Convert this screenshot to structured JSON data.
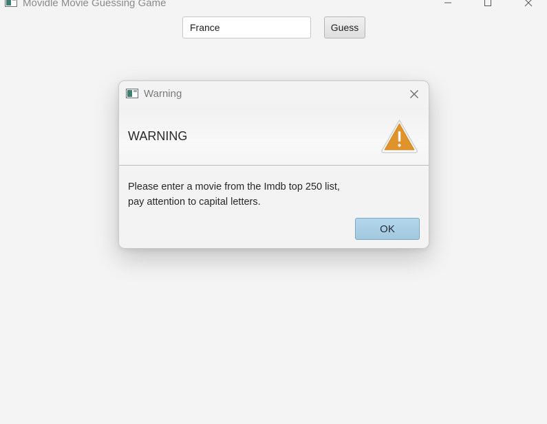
{
  "window": {
    "title": "Movidle Movie Guessing Game",
    "icon": "app-window-icon",
    "controls": {
      "minimize": "minimize-icon",
      "maximize": "maximize-icon",
      "close": "close-icon"
    }
  },
  "guess": {
    "input_value": "France",
    "button_label": "Guess"
  },
  "dialog": {
    "title": "Warning",
    "header_text": "WARNING",
    "header_icon": "warning-triangle-icon",
    "message_lines": [
      "Please enter a movie from the Imdb top 250 list,",
      "pay attention to capital letters."
    ],
    "ok_label": "OK"
  },
  "colors": {
    "background": "#f4f4f4",
    "ok_button": "#a8cde2",
    "warning_icon": "#e3952a"
  }
}
